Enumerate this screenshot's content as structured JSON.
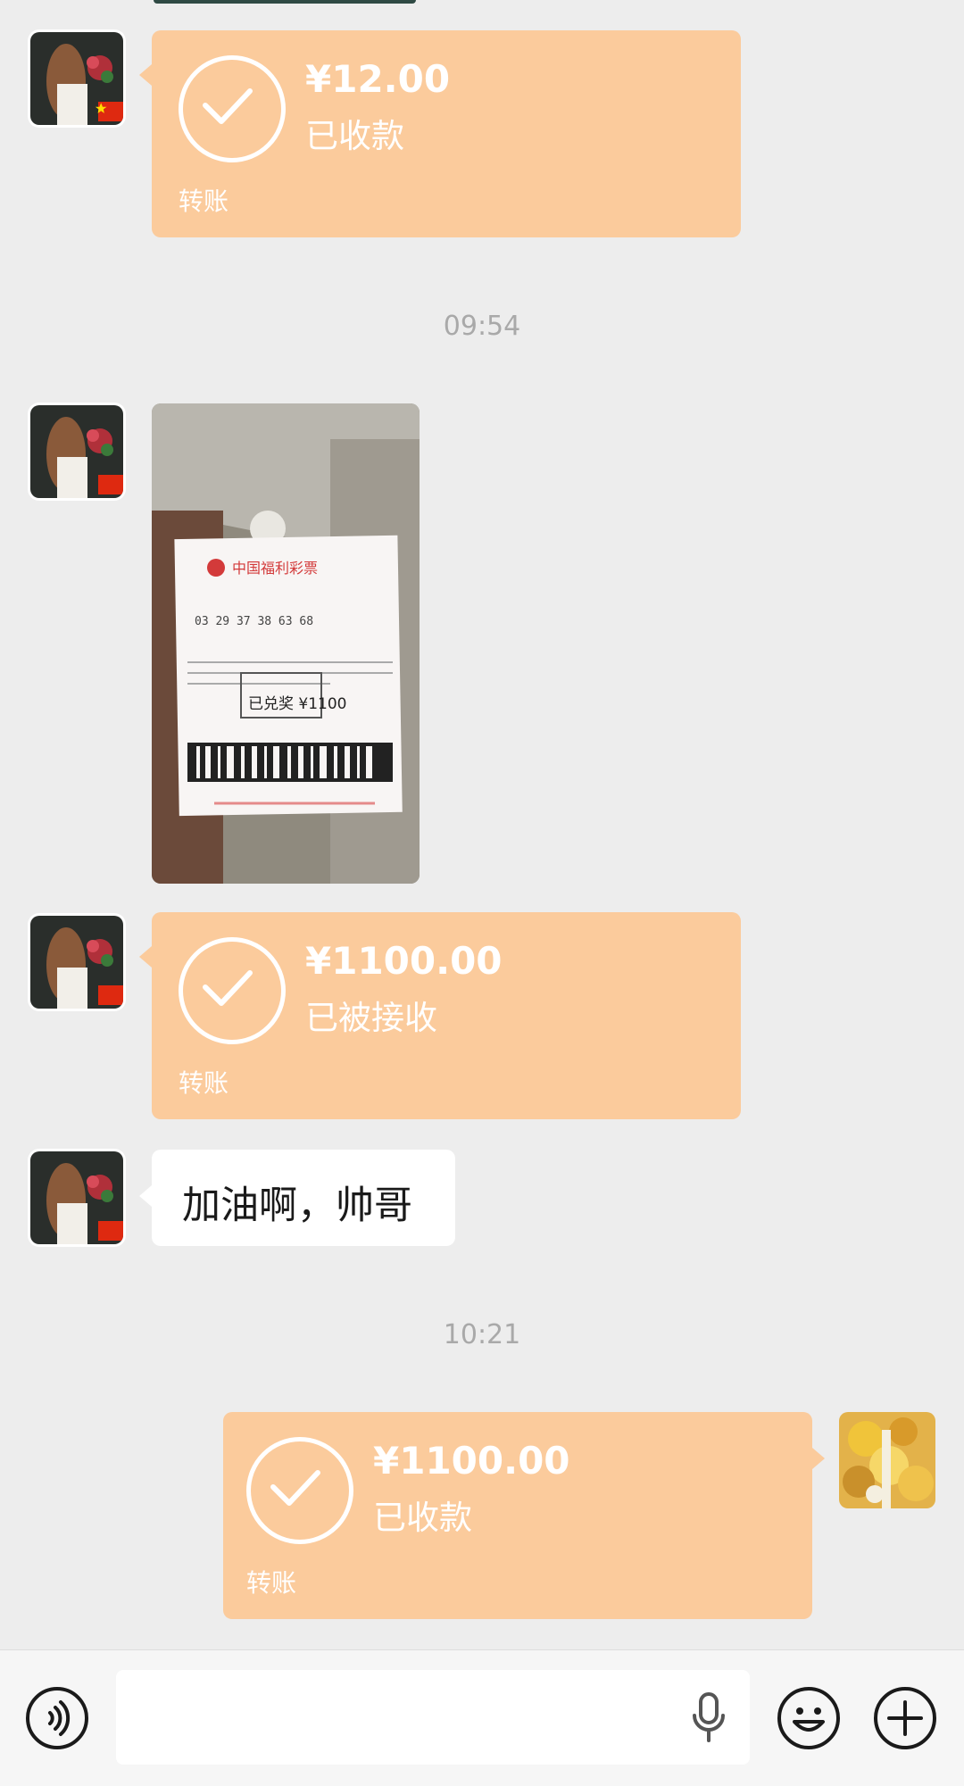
{
  "messages": {
    "m1": {
      "amount": "¥12.00",
      "status": "已收款",
      "type": "转账"
    },
    "t1": "09:54",
    "m3": {
      "amount": "¥1100.00",
      "status": "已被接收",
      "type": "转账"
    },
    "m4": {
      "text": "加油啊，帅哥"
    },
    "t2": "10:21",
    "m5": {
      "amount": "¥1100.00",
      "status": "已收款",
      "type": "转账"
    }
  },
  "photo": {
    "ticket_header": "中国福利彩票",
    "ticket_numbers": "03 29 37 38 63 68",
    "ticket_stamp": "已兑奖 ¥1100"
  },
  "colors": {
    "transfer_bubble": "#fbcb9c",
    "background": "#ededed",
    "text_bubble": "#ffffff"
  },
  "input": {
    "placeholder": ""
  },
  "icons": [
    "voice-toggle-icon",
    "microphone-icon",
    "emoji-icon",
    "plus-icon",
    "check-icon"
  ]
}
